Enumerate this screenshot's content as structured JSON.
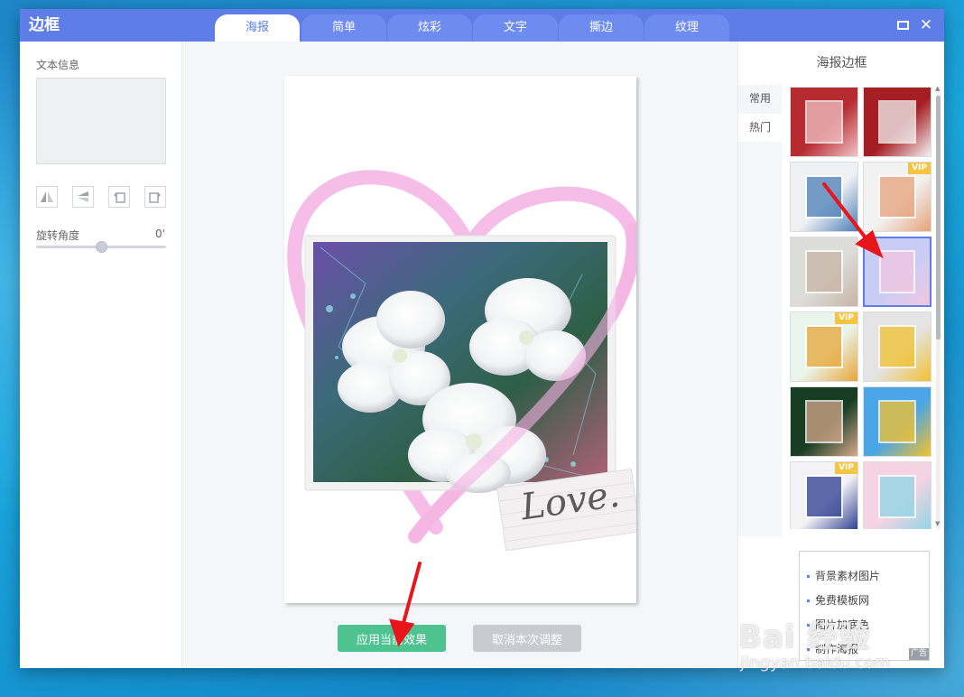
{
  "app": {
    "title": "边框"
  },
  "tabs": [
    {
      "label": "海报",
      "active": true
    },
    {
      "label": "简单",
      "active": false
    },
    {
      "label": "炫彩",
      "active": false
    },
    {
      "label": "文字",
      "active": false
    },
    {
      "label": "撕边",
      "active": false
    },
    {
      "label": "纹理",
      "active": false
    }
  ],
  "window_controls": {
    "maximize_icon": "maximize-icon",
    "close_icon": "close-icon",
    "close_glyph": "✕"
  },
  "left_panel": {
    "text_info_label": "文本信息",
    "tools": [
      "flip-horizontal-icon",
      "flip-vertical-icon",
      "rotate-left-icon",
      "rotate-right-icon"
    ],
    "rotate_label": "旋转角度",
    "rotate_value": "0'",
    "rotate_slider_level": 0.5
  },
  "canvas": {
    "poster_text": "Love.",
    "apply_button": "应用当前效果",
    "cancel_button": "取消本次调整"
  },
  "right_panel": {
    "title": "海报边框",
    "side_tabs": [
      {
        "label": "常用",
        "active": false
      },
      {
        "label": "热门",
        "active": true
      }
    ],
    "thumbnails": [
      {
        "vip": false,
        "selected": false,
        "palette": [
          "#b52b30",
          "#f2c3c7"
        ]
      },
      {
        "vip": false,
        "selected": false,
        "palette": [
          "#a51e23",
          "#f4f4f4"
        ]
      },
      {
        "vip": false,
        "selected": false,
        "palette": [
          "#eef0f3",
          "#4a7fb8"
        ]
      },
      {
        "vip": true,
        "selected": false,
        "palette": [
          "#f2f2f2",
          "#e6a27a"
        ]
      },
      {
        "vip": false,
        "selected": false,
        "palette": [
          "#dcdcd8",
          "#c8b4a6"
        ]
      },
      {
        "vip": false,
        "selected": true,
        "palette": [
          "#c9cdf6",
          "#f1c6df"
        ]
      },
      {
        "vip": true,
        "selected": false,
        "palette": [
          "#e9f5ea",
          "#e8a637"
        ]
      },
      {
        "vip": false,
        "selected": false,
        "palette": [
          "#e4e4e4",
          "#f2c12e"
        ]
      },
      {
        "vip": false,
        "selected": false,
        "palette": [
          "#173d23",
          "#d9a98c"
        ]
      },
      {
        "vip": false,
        "selected": false,
        "palette": [
          "#4aa6e6",
          "#f7c22a"
        ]
      },
      {
        "vip": true,
        "selected": false,
        "palette": [
          "#f3f3f6",
          "#2b3c8e"
        ]
      },
      {
        "vip": false,
        "selected": false,
        "palette": [
          "#f5d3e2",
          "#8fd6e6"
        ]
      }
    ],
    "vip_label": "VIP"
  },
  "ad": {
    "links": [
      "背景素材图片",
      "免费模板网",
      "图片加底色",
      "制作海报"
    ],
    "label": "广告"
  },
  "watermark": {
    "main": "Bai 经验",
    "sub": "jingyan.baidu.com"
  }
}
